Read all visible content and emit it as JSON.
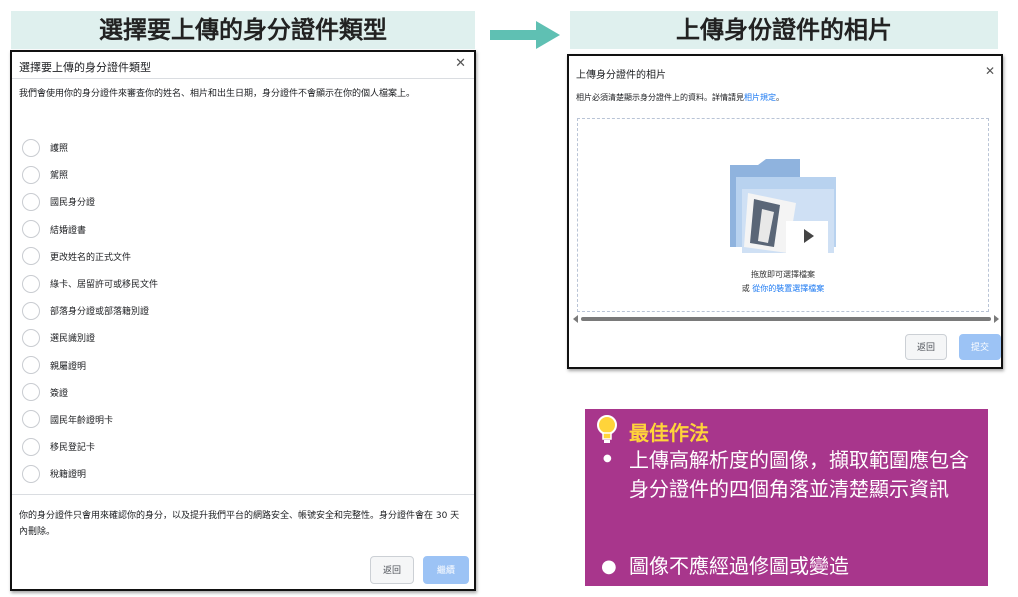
{
  "banners": {
    "left": "選擇要上傳的身分證件類型",
    "right": "上傳身份證件的相片"
  },
  "left_dialog": {
    "title": "選擇要上傳的身分證件類型",
    "description": "我們會使用你的身分證件來審查你的姓名、相片和出生日期，身分證件不會顯示在你的個人檔案上。",
    "options": [
      "護照",
      "駕照",
      "國民身分證",
      "結婚證書",
      "更改姓名的正式文件",
      "綠卡、居留許可或移民文件",
      "部落身分證或部落籍別證",
      "選民識別證",
      "親屬證明",
      "簽證",
      "國民年齡證明卡",
      "移民登記卡",
      "稅籍證明"
    ],
    "footer_text": "你的身分證件只會用來確認你的身分，以及提升我們平台的網路安全、帳號安全和完整性。身分證件會在 30 天內刪除。",
    "back_label": "返回",
    "continue_label": "繼續"
  },
  "right_dialog": {
    "title": "上傳身分證件的相片",
    "description_prefix": "相片必須清楚顯示身分證件上的資料。詳情請見",
    "description_link": "相片規定",
    "description_suffix": "。",
    "drop_text": "拖放即可選擇檔案",
    "choose_prefix": "或 ",
    "choose_link": "從你的裝置選擇檔案",
    "back_label": "返回",
    "submit_label": "提交"
  },
  "tips": {
    "heading": "最佳作法",
    "items": [
      "上傳高解析度的圖像，擷取範圍應包含身分證件的四個角落並清楚顯示資訊",
      "圖像不應經過修圖或變造"
    ]
  },
  "colors": {
    "banner_bg": "#dff0ee",
    "arrow": "#5fc0b3",
    "link": "#1877f2",
    "primary_button": "#9cc3f5",
    "tip_bg": "#a8368c",
    "tip_heading": "#ffd43a"
  },
  "icons": {
    "close": "close-icon",
    "lightbulb": "lightbulb-icon",
    "folder": "folder-upload-icon"
  }
}
